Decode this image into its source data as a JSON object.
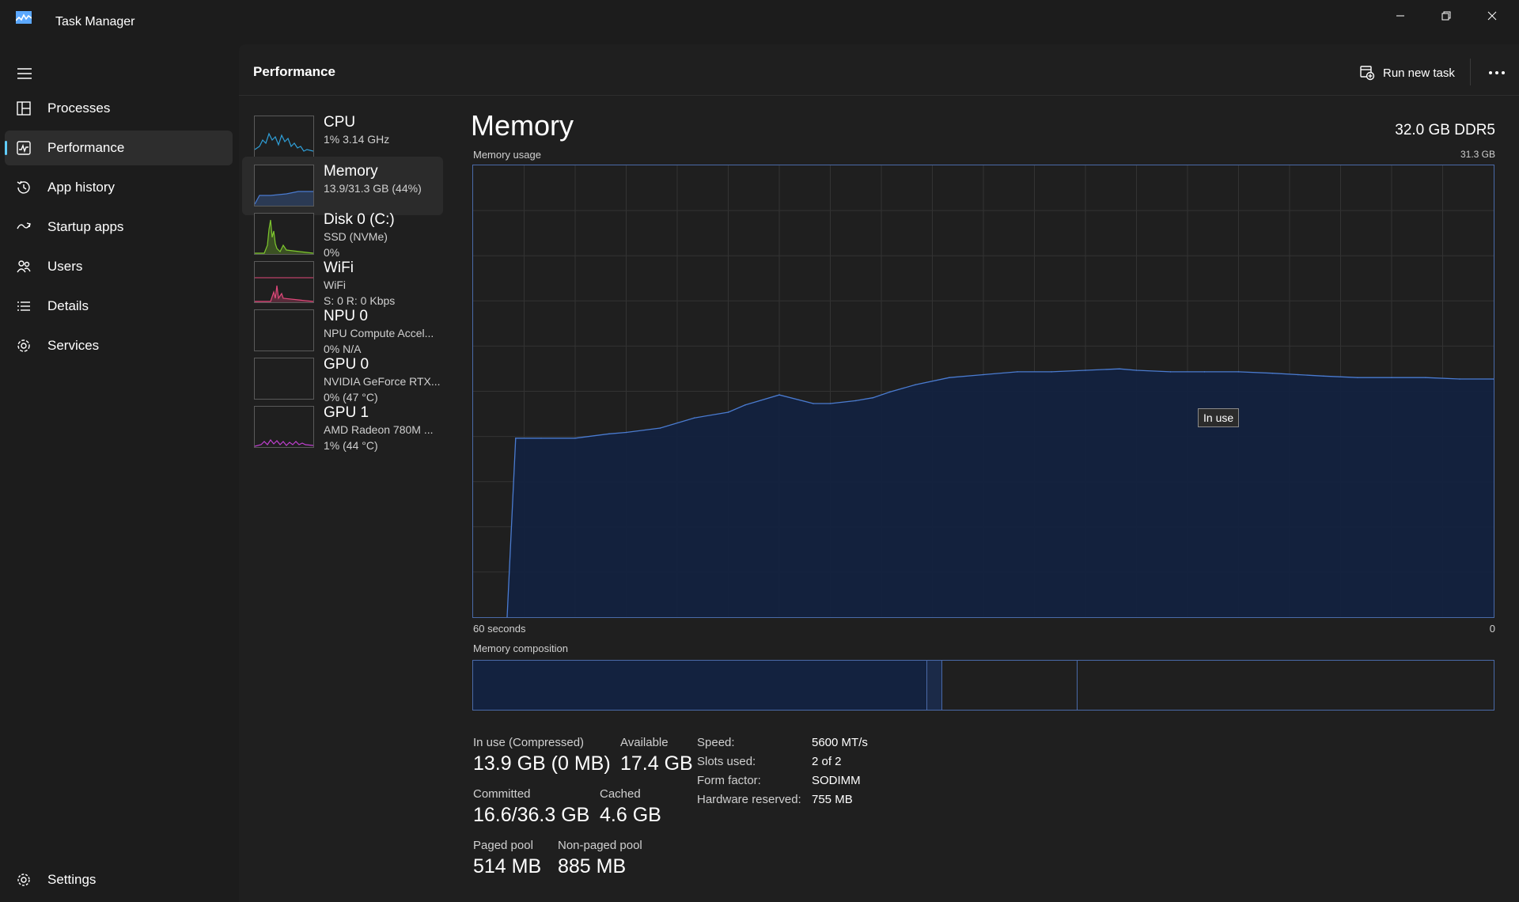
{
  "app": {
    "title": "Task Manager",
    "icon": "task-manager-icon"
  },
  "window": {
    "minimize_icon": "minimize-icon",
    "restore_icon": "restore-icon",
    "close_icon": "close-icon"
  },
  "sidebar": {
    "items": [
      {
        "label": "Processes",
        "icon": "processes-icon"
      },
      {
        "label": "Performance",
        "icon": "performance-icon",
        "active": true
      },
      {
        "label": "App history",
        "icon": "history-icon"
      },
      {
        "label": "Startup apps",
        "icon": "startup-icon"
      },
      {
        "label": "Users",
        "icon": "users-icon"
      },
      {
        "label": "Details",
        "icon": "details-icon"
      },
      {
        "label": "Services",
        "icon": "services-icon"
      }
    ],
    "settings_label": "Settings"
  },
  "header": {
    "title": "Performance",
    "run_new_task": "Run new task"
  },
  "resources": [
    {
      "name": "CPU",
      "sub1": "1%  3.14 GHz",
      "sub2": "",
      "color": "#2f9fd8"
    },
    {
      "name": "Memory",
      "sub1": "13.9/31.3 GB (44%)",
      "sub2": "",
      "color": "#4a7bd0"
    },
    {
      "name": "Disk 0 (C:)",
      "sub1": "SSD (NVMe)",
      "sub2": "0%",
      "color": "#7ec82e"
    },
    {
      "name": "WiFi",
      "sub1": "WiFi",
      "sub2": "S: 0  R: 0 Kbps",
      "color": "#e0487a"
    },
    {
      "name": "NPU 0",
      "sub1": "NPU Compute Accel...",
      "sub2": "0%  N/A",
      "color": "#888888"
    },
    {
      "name": "GPU 0",
      "sub1": "NVIDIA GeForce RTX...",
      "sub2": "0%  (47 °C)",
      "color": "#888888"
    },
    {
      "name": "GPU 1",
      "sub1": "AMD Radeon 780M ...",
      "sub2": "1%  (44 °C)",
      "color": "#c040d0"
    }
  ],
  "memory": {
    "title": "Memory",
    "type": "32.0 GB DDR5",
    "usage_label": "Memory usage",
    "usage_max": "31.3 GB",
    "tooltip": "In use",
    "time_left": "60 seconds",
    "time_right": "0",
    "composition_label": "Memory composition",
    "composition": {
      "in_use": 0.445,
      "modified": 0.015,
      "standby": 0.132,
      "free": 0.408
    },
    "stats": {
      "in_use_label": "In use (Compressed)",
      "in_use_value": "13.9 GB (0 MB)",
      "available_label": "Available",
      "available_value": "17.4 GB",
      "committed_label": "Committed",
      "committed_value": "16.6/36.3 GB",
      "cached_label": "Cached",
      "cached_value": "4.6 GB",
      "paged_label": "Paged pool",
      "paged_value": "514 MB",
      "nonpaged_label": "Non-paged pool",
      "nonpaged_value": "885 MB"
    },
    "specs": [
      {
        "label": "Speed:",
        "value": "5600 MT/s"
      },
      {
        "label": "Slots used:",
        "value": "2 of 2"
      },
      {
        "label": "Form factor:",
        "value": "SODIMM"
      },
      {
        "label": "Hardware reserved:",
        "value": "755 MB"
      }
    ]
  },
  "chart_data": {
    "type": "area",
    "title": "Memory usage",
    "xlabel": "",
    "ylabel": "",
    "x": [
      60,
      58,
      57.5,
      56,
      54,
      52,
      51,
      49,
      47,
      45,
      44,
      42,
      40,
      39,
      37.5,
      36.5,
      35.5,
      34,
      32,
      30,
      28,
      26,
      24,
      22,
      21,
      19,
      17,
      15,
      13,
      11.5,
      10,
      8,
      6,
      4,
      2,
      0
    ],
    "values": [
      null,
      0,
      12.4,
      12.4,
      12.4,
      12.7,
      12.8,
      13.1,
      13.8,
      14.2,
      14.7,
      15.4,
      14.8,
      14.8,
      15.0,
      15.2,
      15.6,
      16.1,
      16.6,
      16.8,
      17.0,
      17.0,
      17.1,
      17.2,
      17.1,
      17.0,
      17.0,
      17.0,
      16.9,
      16.8,
      16.7,
      16.6,
      16.6,
      16.6,
      16.5,
      16.5
    ],
    "xlim": [
      60,
      0
    ],
    "ylim": [
      0,
      31.3
    ],
    "grid": true,
    "color": "#4a7bd0"
  }
}
